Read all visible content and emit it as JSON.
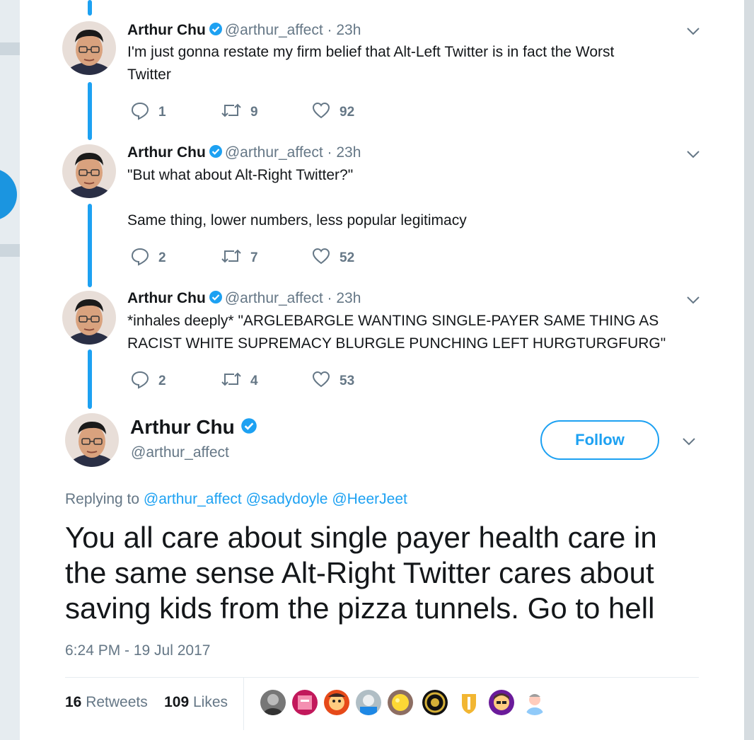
{
  "thread": [
    {
      "name": "Arthur Chu",
      "handle": "@arthur_affect",
      "time": "23h",
      "text_lines": [
        "I'm just gonna restate my firm belief that Alt-Left Twitter is in fact the Worst",
        "Twitter"
      ],
      "replies": "1",
      "retweets": "9",
      "likes": "92"
    },
    {
      "name": "Arthur Chu",
      "handle": "@arthur_affect",
      "time": "23h",
      "text_lines": [
        "\"But what about Alt-Right Twitter?\"",
        "",
        "Same thing, lower numbers, less popular legitimacy"
      ],
      "replies": "2",
      "retweets": "7",
      "likes": "52"
    },
    {
      "name": "Arthur Chu",
      "handle": "@arthur_affect",
      "time": "23h",
      "text_lines": [
        "*inhales deeply* \"ARGLEBARGLE WANTING SINGLE-PAYER SAME THING AS",
        "RACIST WHITE SUPREMACY BLURGLE PUNCHING LEFT HURGTURGFURG\""
      ],
      "replies": "2",
      "retweets": "4",
      "likes": "53"
    }
  ],
  "main_tweet": {
    "name": "Arthur Chu",
    "handle": "@arthur_affect",
    "follow_label": "Follow",
    "replying_prefix": "Replying to",
    "replying_to": [
      "@arthur_affect",
      "@sadydoyle",
      "@HeerJeet"
    ],
    "text_lines": [
      "You all care about single payer health care in",
      "the same sense Alt-Right Twitter cares about",
      "saving kids from the pizza tunnels. Go to hell"
    ],
    "timestamp": "6:24 PM - 19 Jul 2017",
    "retweet_count": "16",
    "retweet_label": "Retweets",
    "like_count": "109",
    "like_label": "Likes"
  },
  "colors": {
    "accent": "#1da1f2",
    "secondary_text": "#657786",
    "primary_text": "#14171a"
  },
  "likers": [
    {
      "icon": "liker-avatar-grayscale"
    },
    {
      "icon": "liker-avatar-pink"
    },
    {
      "icon": "liker-avatar-cartoon"
    },
    {
      "icon": "liker-avatar-photo"
    },
    {
      "icon": "liker-avatar-yellow"
    },
    {
      "icon": "liker-avatar-gold-emblem"
    },
    {
      "icon": "liker-avatar-gold-shield"
    },
    {
      "icon": "liker-avatar-purple"
    },
    {
      "icon": "liker-avatar-cartoon-man"
    }
  ]
}
